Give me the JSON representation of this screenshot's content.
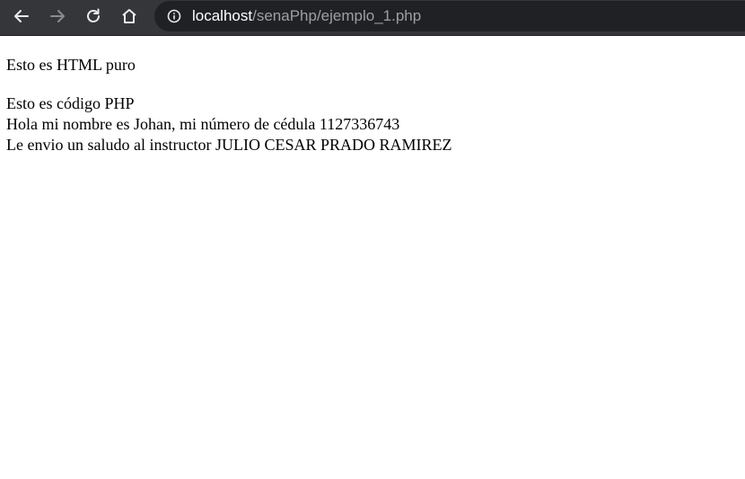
{
  "browser": {
    "url_host": "localhost",
    "url_path": "/senaPhp/ejemplo_1.php",
    "icons": {
      "back": "back-arrow-icon",
      "forward": "forward-arrow-icon",
      "reload": "reload-icon",
      "home": "home-icon",
      "info": "info-icon"
    },
    "colors": {
      "toolbar": "#35363a",
      "omnibox": "#202124",
      "host_text": "#ffffff",
      "path_text": "#9aa0a6"
    }
  },
  "page": {
    "line_html": "Esto es HTML puro",
    "line_php": "Esto es código PHP",
    "line_name": "Hola mi nombre es Johan, mi número de cédula 1127336743",
    "line_greeting": "Le envio un saludo al instructor JULIO CESAR PRADO RAMIREZ"
  }
}
